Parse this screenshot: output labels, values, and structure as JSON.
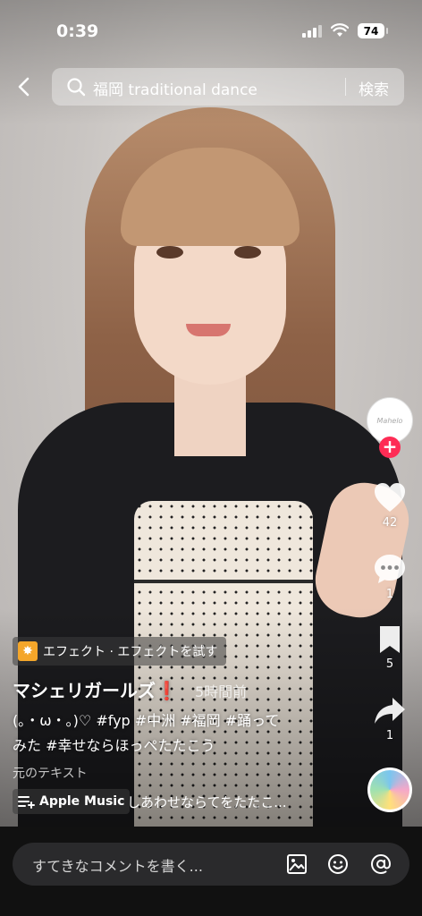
{
  "status_bar": {
    "time": "0:39",
    "battery": "74"
  },
  "search": {
    "query": "福岡 traditional dance",
    "button_label": "検索"
  },
  "rail": {
    "avatar_text": "Mahelo",
    "likes": "42",
    "comments": "1",
    "saves": "5",
    "shares": "1"
  },
  "post": {
    "effect_label": "エフェクト · エフェクトを試す",
    "username": "マシェリガールズ",
    "username_mark": "❗",
    "time_ago": "5時間前",
    "caption_line1": "(｡・ω・｡)♡ #fyp #中洲 #福岡 #踊って",
    "caption_line2": "みた #幸せならほっぺたたこう",
    "original_text_label": "元のテキスト",
    "music_source": "Apple Music",
    "music_track": "しあわせならてをたたこ..."
  },
  "comment_bar": {
    "placeholder": "すてきなコメントを書く..."
  },
  "colors": {
    "accent_red": "#fe2c55",
    "effect_icon": "#f4a62a"
  }
}
